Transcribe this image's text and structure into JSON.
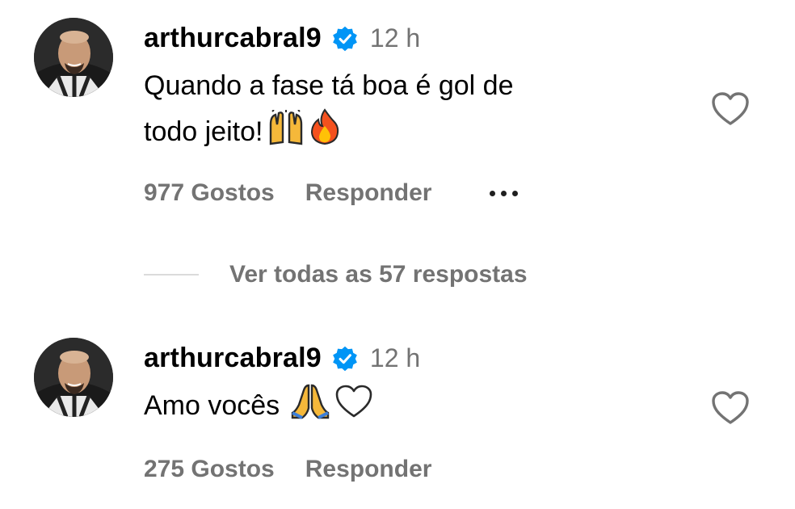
{
  "comments": [
    {
      "username": "arthurcabral9",
      "time": "12 h",
      "text_line1": "Quando a fase tá boa é gol de",
      "text_line2": "todo jeito!",
      "emoji_icons": [
        "raising-hands-icon",
        "fire-icon"
      ],
      "likes": "977 Gostos",
      "reply_label": "Responder"
    },
    {
      "username": "arthurcabral9",
      "time": "12 h",
      "text_line1": "Amo vocês",
      "emoji_icons": [
        "folded-hands-icon",
        "white-heart-icon"
      ],
      "likes": "275 Gostos",
      "reply_label": "Responder"
    }
  ],
  "replies_toggle": "Ver todas as 57 respostas",
  "colors": {
    "verified": "#0095f6",
    "secondary_text": "#737373",
    "divider": "#dbdbdb"
  }
}
